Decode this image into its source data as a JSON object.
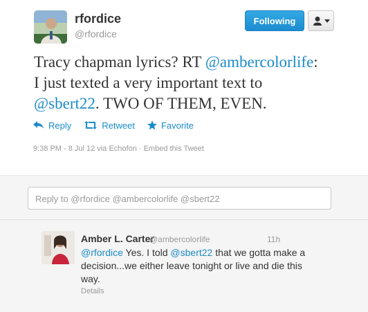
{
  "tweet": {
    "display_name": "rfordice",
    "screen_name": "@rfordice",
    "text_parts": {
      "t1": "Tracy chapman lyrics? RT ",
      "m1": "@ambercolorlife",
      "t2": ":",
      "t3": "I just texted a very important text to",
      "m2": "@sbert22",
      "t4": ". TWO OF THEM, EVEN."
    },
    "actions": {
      "reply": "Reply",
      "retweet": "Retweet",
      "favorite": "Favorite"
    },
    "meta": "9:38 PM - 8 Jul 12 via Echofon · Embed this Tweet"
  },
  "header_buttons": {
    "follow_label": "Following"
  },
  "reply_box": {
    "placeholder": "Reply to @rfordice @ambercolorlife @sbert22"
  },
  "reply_tweet": {
    "name": "Amber L. Carter",
    "handle": "@ambercolorlife",
    "time": "11h",
    "text_parts": {
      "m1": "@rfordice",
      "t1": " Yes. I told ",
      "m2": "@sbert22",
      "t2": " that we gotta make a decision...we either leave tonight or live and die this way."
    },
    "details": "Details"
  },
  "colors": {
    "link": "#1a8bc8",
    "follow_button": "#1c8dd0",
    "muted": "#999999",
    "reply_bg": "#f5f5f5"
  },
  "icons": [
    "reply-icon",
    "retweet-icon",
    "favorite-star-icon",
    "user-icon",
    "caret-down-icon"
  ]
}
